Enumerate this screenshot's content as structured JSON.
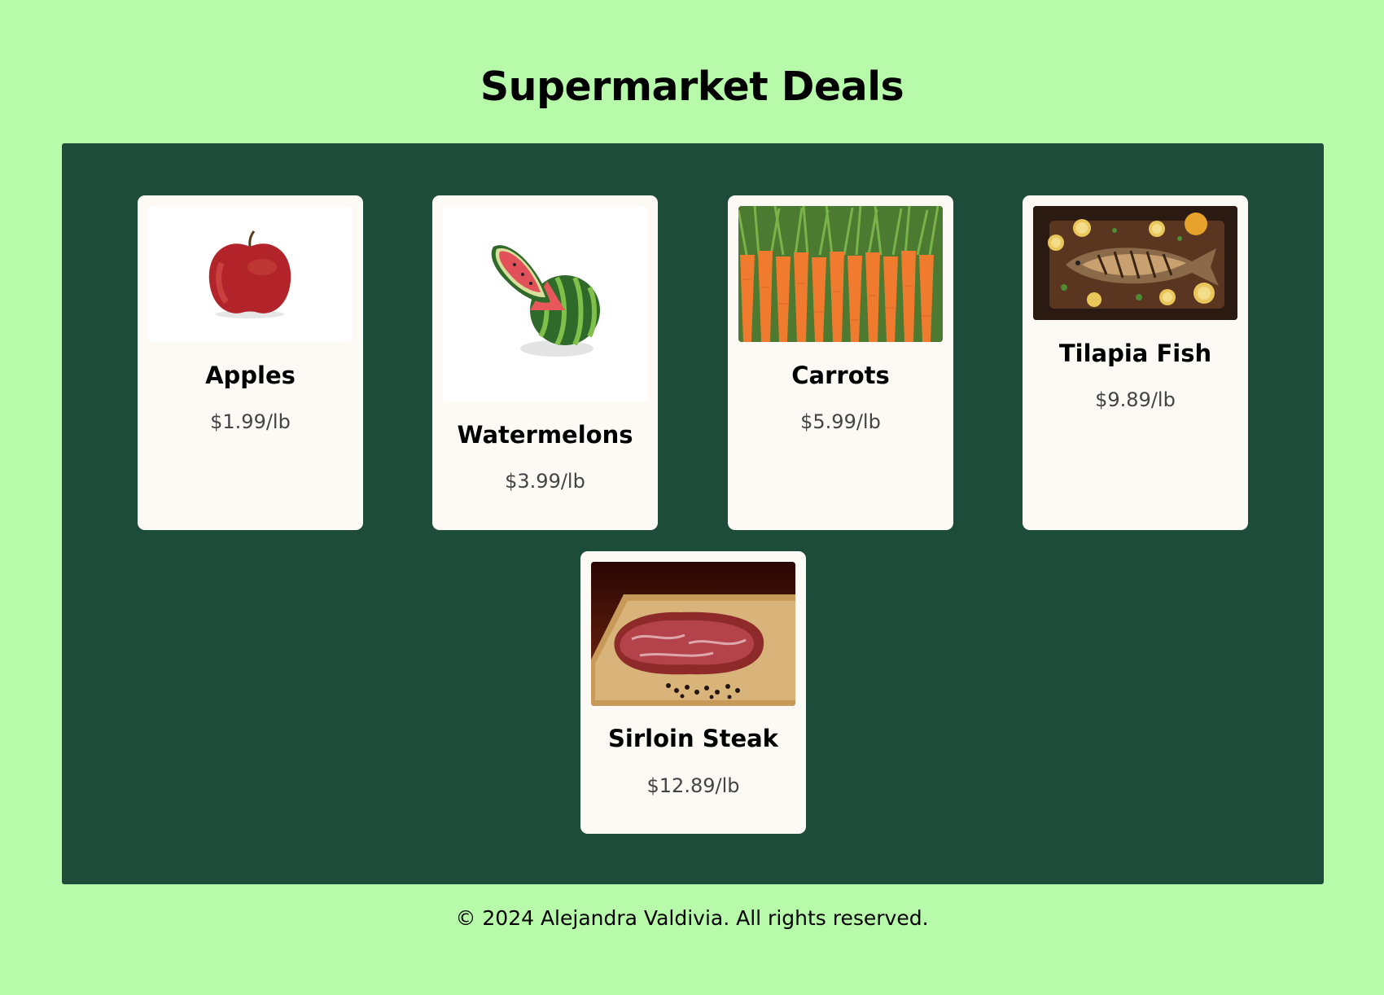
{
  "header": {
    "title": "Supermarket Deals"
  },
  "products": [
    {
      "name": "Apples",
      "price": "$1.99/lb",
      "icon": "apple-photo"
    },
    {
      "name": "Watermelons",
      "price": "$3.99/lb",
      "icon": "watermelon-photo"
    },
    {
      "name": "Carrots",
      "price": "$5.99/lb",
      "icon": "carrots-photo"
    },
    {
      "name": "Tilapia Fish",
      "price": "$9.89/lb",
      "icon": "fish-photo"
    },
    {
      "name": "Sirloin Steak",
      "price": "$12.89/lb",
      "icon": "steak-photo"
    }
  ],
  "footer": {
    "text": "© 2024 Alejandra Valdivia. All rights reserved."
  },
  "colors": {
    "page_background": "#b7fbaa",
    "panel_background": "#1e4c3a",
    "card_background": "#fdf9f4"
  }
}
